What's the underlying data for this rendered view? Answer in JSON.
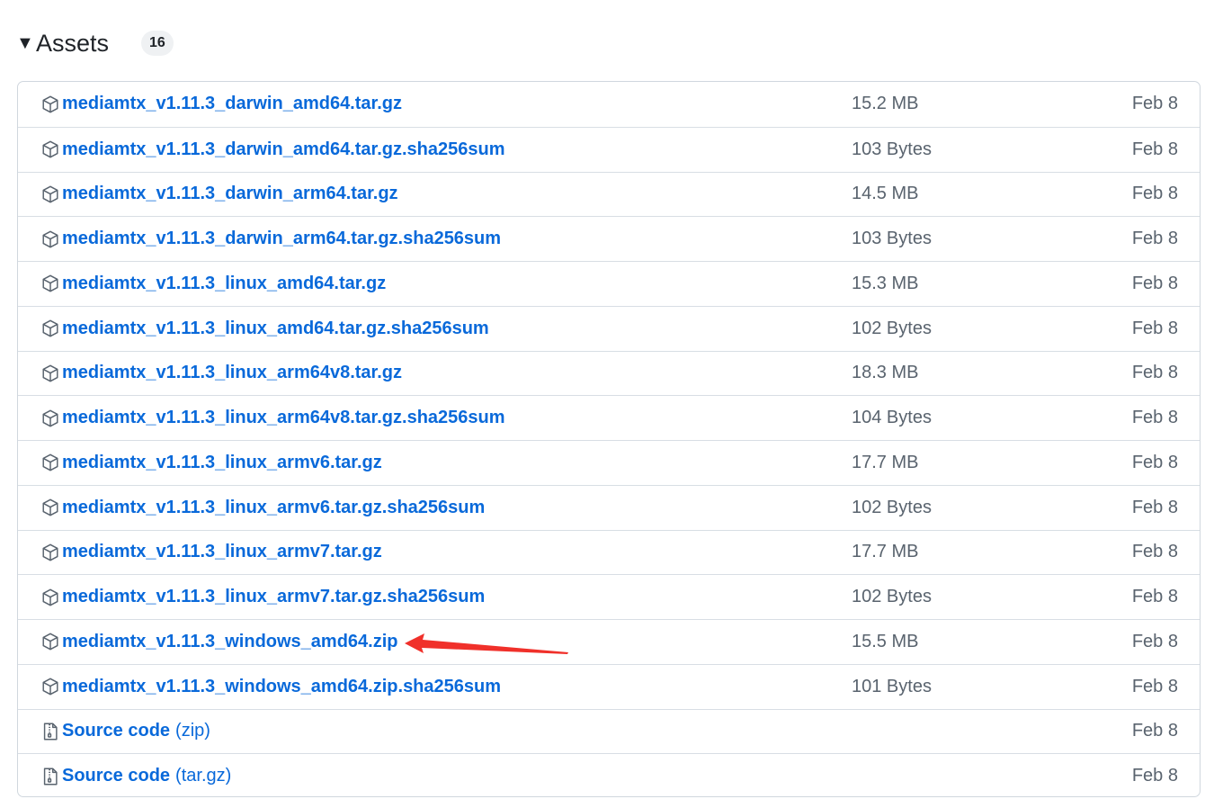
{
  "assets_header": {
    "toggle_icon": "triangle-down-icon",
    "title": "Assets",
    "count": "16"
  },
  "assets": [
    {
      "name": "mediamtx_v1.11.3_darwin_amd64.tar.gz",
      "size": "15.2 MB",
      "date": "Feb 8",
      "icon": "package-icon"
    },
    {
      "name": "mediamtx_v1.11.3_darwin_amd64.tar.gz.sha256sum",
      "size": "103 Bytes",
      "date": "Feb 8",
      "icon": "package-icon"
    },
    {
      "name": "mediamtx_v1.11.3_darwin_arm64.tar.gz",
      "size": "14.5 MB",
      "date": "Feb 8",
      "icon": "package-icon"
    },
    {
      "name": "mediamtx_v1.11.3_darwin_arm64.tar.gz.sha256sum",
      "size": "103 Bytes",
      "date": "Feb 8",
      "icon": "package-icon"
    },
    {
      "name": "mediamtx_v1.11.3_linux_amd64.tar.gz",
      "size": "15.3 MB",
      "date": "Feb 8",
      "icon": "package-icon"
    },
    {
      "name": "mediamtx_v1.11.3_linux_amd64.tar.gz.sha256sum",
      "size": "102 Bytes",
      "date": "Feb 8",
      "icon": "package-icon"
    },
    {
      "name": "mediamtx_v1.11.3_linux_arm64v8.tar.gz",
      "size": "18.3 MB",
      "date": "Feb 8",
      "icon": "package-icon"
    },
    {
      "name": "mediamtx_v1.11.3_linux_arm64v8.tar.gz.sha256sum",
      "size": "104 Bytes",
      "date": "Feb 8",
      "icon": "package-icon"
    },
    {
      "name": "mediamtx_v1.11.3_linux_armv6.tar.gz",
      "size": "17.7 MB",
      "date": "Feb 8",
      "icon": "package-icon"
    },
    {
      "name": "mediamtx_v1.11.3_linux_armv6.tar.gz.sha256sum",
      "size": "102 Bytes",
      "date": "Feb 8",
      "icon": "package-icon"
    },
    {
      "name": "mediamtx_v1.11.3_linux_armv7.tar.gz",
      "size": "17.7 MB",
      "date": "Feb 8",
      "icon": "package-icon"
    },
    {
      "name": "mediamtx_v1.11.3_linux_armv7.tar.gz.sha256sum",
      "size": "102 Bytes",
      "date": "Feb 8",
      "icon": "package-icon"
    },
    {
      "name": "mediamtx_v1.11.3_windows_amd64.zip",
      "size": "15.5 MB",
      "date": "Feb 8",
      "icon": "package-icon",
      "annotated": true
    },
    {
      "name": "mediamtx_v1.11.3_windows_amd64.zip.sha256sum",
      "size": "101 Bytes",
      "date": "Feb 8",
      "icon": "package-icon"
    },
    {
      "name": "Source code",
      "suffix": "(zip)",
      "size": "",
      "date": "Feb 8",
      "icon": "file-zip-icon"
    },
    {
      "name": "Source code",
      "suffix": "(tar.gz)",
      "size": "",
      "date": "Feb 8",
      "icon": "file-zip-icon"
    }
  ],
  "colors": {
    "link": "#0969da",
    "muted": "#59636e",
    "border": "#d0d7de",
    "annotation_arrow": "#f0302a"
  }
}
